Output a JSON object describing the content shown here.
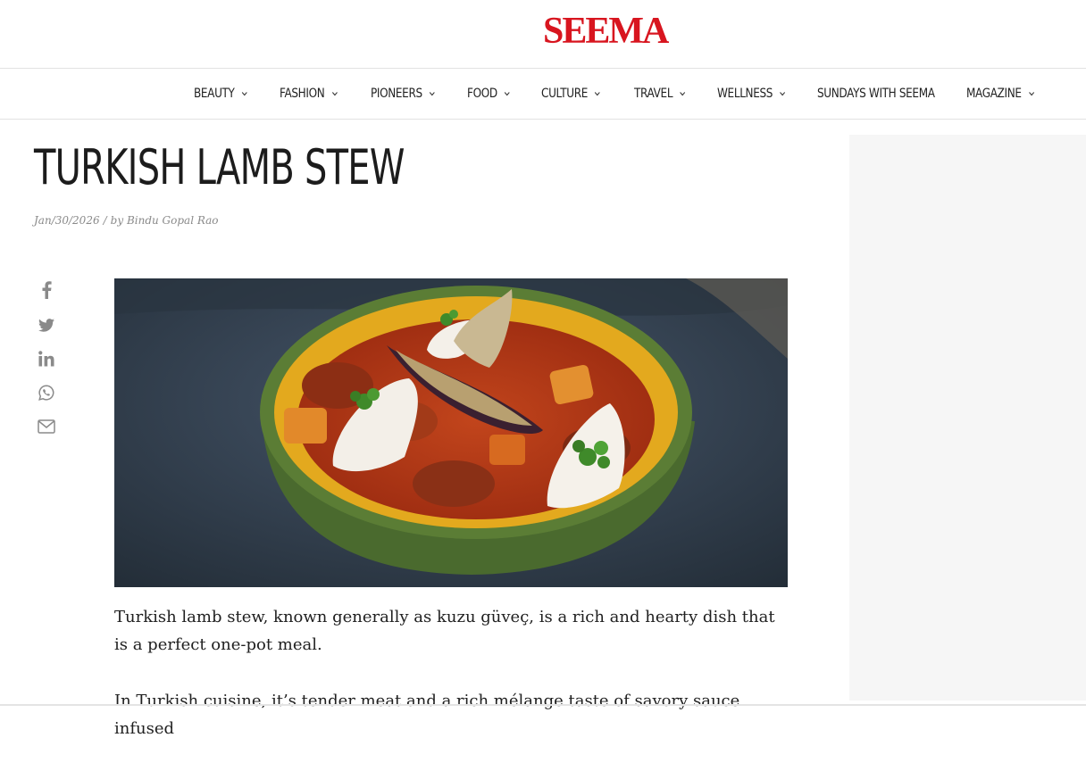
{
  "brand": {
    "logo_text": "SEEMA",
    "logo_color": "#d8151f"
  },
  "nav": {
    "items": [
      {
        "label": "BEAUTY",
        "has_dropdown": true
      },
      {
        "label": "FASHION",
        "has_dropdown": true
      },
      {
        "label": "PIONEERS",
        "has_dropdown": true
      },
      {
        "label": "FOOD",
        "has_dropdown": true
      },
      {
        "label": "CULTURE",
        "has_dropdown": true
      },
      {
        "label": "TRAVEL",
        "has_dropdown": true
      },
      {
        "label": "WELLNESS",
        "has_dropdown": true
      },
      {
        "label": "SUNDAYS WITH SEEMA",
        "has_dropdown": false
      },
      {
        "label": "MAGAZINE",
        "has_dropdown": true
      }
    ]
  },
  "article": {
    "title": "TURKISH LAMB STEW",
    "date": "Jan/30/2026",
    "separator": "/",
    "by": "by",
    "author": "Bindu Gopal Rao",
    "paragraphs": [
      "Turkish lamb stew, known generally as kuzu güveç, is a rich and hearty dish that is a perfect one-pot meal.",
      "In Turkish cuisine, it’s tender meat and a rich mélange taste of savory sauce infused"
    ]
  },
  "share": {
    "icons": [
      "facebook-icon",
      "twitter-icon",
      "linkedin-icon",
      "whatsapp-icon",
      "email-icon"
    ]
  }
}
